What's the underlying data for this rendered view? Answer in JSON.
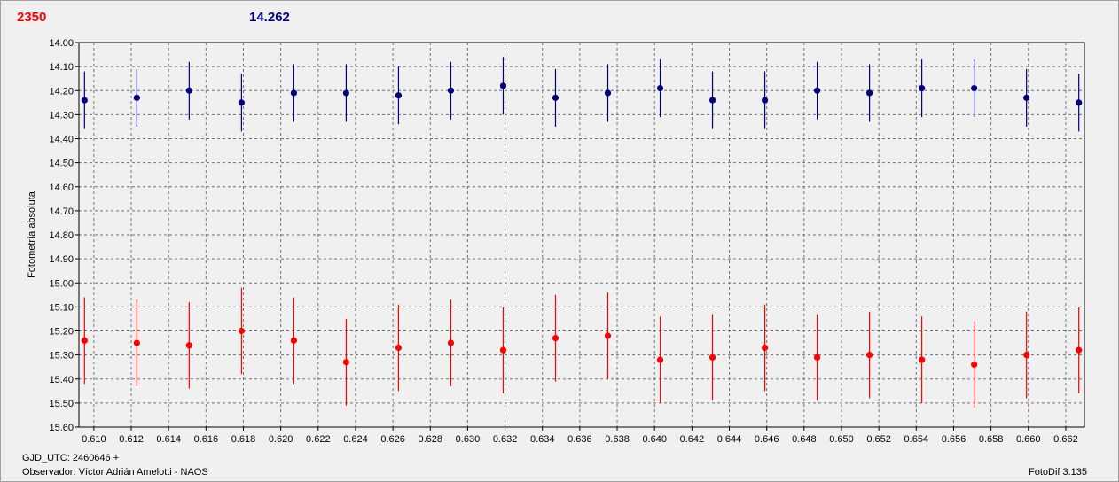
{
  "header": {
    "left_value": "2350",
    "right_value": "14.262"
  },
  "footer": {
    "gjd": "GJD_UTC: 2460646 +",
    "observer": "Observador: Víctor Adrián Amelotti - NAOS",
    "version": "FotoDif 3.135"
  },
  "colors": {
    "red_series": "#ff0000",
    "blue_series": "#000080",
    "background": "#f0f0f0",
    "grid": "#707070"
  },
  "chart_data": {
    "type": "scatter",
    "ylabel": "Fotometría absoluta",
    "xlabel": "",
    "xlim": [
      0.6092,
      0.663
    ],
    "ylim": [
      15.6,
      14.0
    ],
    "y_inverted": true,
    "grid": true,
    "x_ticks": [
      "0.610",
      "0.612",
      "0.614",
      "0.616",
      "0.618",
      "0.620",
      "0.622",
      "0.624",
      "0.626",
      "0.628",
      "0.630",
      "0.632",
      "0.634",
      "0.636",
      "0.638",
      "0.640",
      "0.642",
      "0.644",
      "0.646",
      "0.648",
      "0.650",
      "0.652",
      "0.654",
      "0.656",
      "0.658",
      "0.660",
      "0.662"
    ],
    "y_ticks": [
      "14.00",
      "14.10",
      "14.20",
      "14.30",
      "14.40",
      "14.50",
      "14.60",
      "14.70",
      "14.80",
      "14.90",
      "15.00",
      "15.10",
      "15.20",
      "15.30",
      "15.40",
      "15.50",
      "15.60"
    ],
    "series": [
      {
        "color": "#000080",
        "x": [
          0.6095,
          0.6123,
          0.6151,
          0.6179,
          0.6207,
          0.6235,
          0.6263,
          0.6291,
          0.6319,
          0.6347,
          0.6375,
          0.6403,
          0.6431,
          0.6459,
          0.6487,
          0.6515,
          0.6543,
          0.6571,
          0.6599,
          0.6627
        ],
        "y": [
          14.24,
          14.23,
          14.2,
          14.25,
          14.21,
          14.21,
          14.22,
          14.2,
          14.18,
          14.23,
          14.21,
          14.19,
          14.24,
          14.24,
          14.2,
          14.21,
          14.19,
          14.19,
          14.23,
          14.25
        ],
        "err": [
          0.12,
          0.12,
          0.12,
          0.12,
          0.12,
          0.12,
          0.12,
          0.12,
          0.12,
          0.12,
          0.12,
          0.12,
          0.12,
          0.12,
          0.12,
          0.12,
          0.12,
          0.12,
          0.12,
          0.12
        ]
      },
      {
        "color": "#ff0000",
        "x": [
          0.6095,
          0.6123,
          0.6151,
          0.6179,
          0.6207,
          0.6235,
          0.6263,
          0.6291,
          0.6319,
          0.6347,
          0.6375,
          0.6403,
          0.6431,
          0.6459,
          0.6487,
          0.6515,
          0.6543,
          0.6571,
          0.6599,
          0.6627
        ],
        "y": [
          15.24,
          15.25,
          15.26,
          15.2,
          15.24,
          15.33,
          15.27,
          15.25,
          15.28,
          15.23,
          15.22,
          15.32,
          15.31,
          15.27,
          15.31,
          15.3,
          15.32,
          15.34,
          15.3,
          15.28
        ],
        "err": [
          0.18,
          0.18,
          0.18,
          0.18,
          0.18,
          0.18,
          0.18,
          0.18,
          0.18,
          0.18,
          0.18,
          0.18,
          0.18,
          0.18,
          0.18,
          0.18,
          0.18,
          0.18,
          0.18,
          0.18
        ]
      }
    ]
  }
}
